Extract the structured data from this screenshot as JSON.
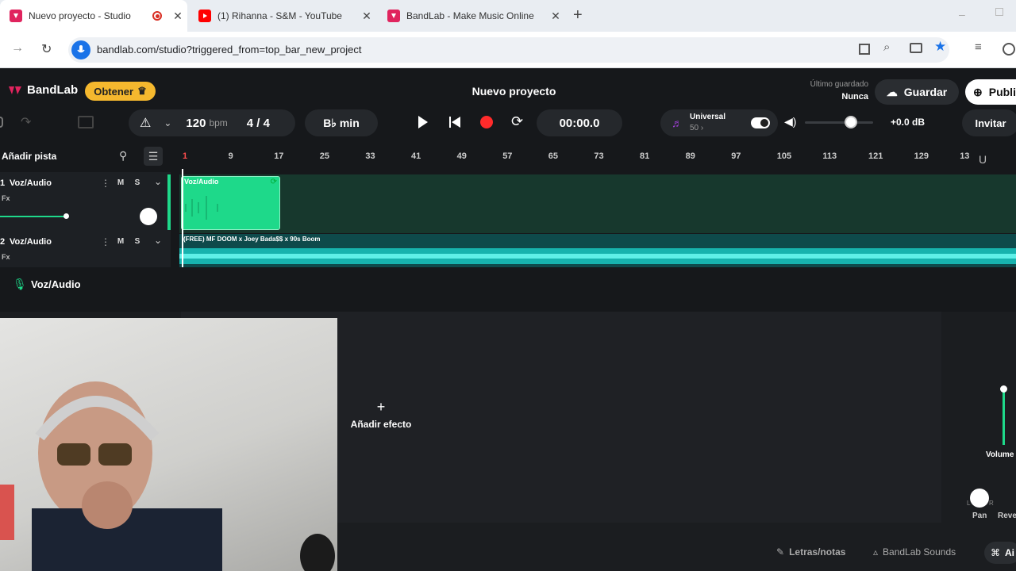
{
  "browser": {
    "tabs": [
      {
        "title": "Nuevo proyecto - Studio",
        "active": true
      },
      {
        "title": "(1) Rihanna - S&M - YouTube",
        "active": false
      },
      {
        "title": "BandLab - Make Music Online",
        "active": false
      }
    ],
    "url": "bandlab.com/studio?triggered_from=top_bar_new_project"
  },
  "header": {
    "logo": "BandLab",
    "obtener": "Obtener",
    "project_title": "Nuevo proyecto",
    "last_saved_label": "Último guardado",
    "last_saved_value": "Nunca",
    "save": "Guardar",
    "publish": "Publi"
  },
  "toolbar": {
    "bpm_value": "120",
    "bpm_unit": "bpm",
    "time_sig": "4 / 4",
    "key": "B♭ min",
    "time": "00:00.0",
    "instrument_name": "Universal",
    "instrument_sub": "50 ›",
    "volume_db": "+0.0 dB",
    "invite": "Invitar"
  },
  "ruler": [
    "1",
    "9",
    "17",
    "25",
    "33",
    "41",
    "49",
    "57",
    "65",
    "73",
    "81",
    "89",
    "97",
    "105",
    "113",
    "121",
    "129",
    "13"
  ],
  "tracks": {
    "add_track": "Añadir pista",
    "items": [
      {
        "num": "1",
        "name": "Voz/Audio",
        "fx": "Fx",
        "m": "M",
        "s": "S"
      },
      {
        "num": "2",
        "name": "Voz/Audio",
        "fx": "Fx",
        "m": "M",
        "s": "S"
      }
    ]
  },
  "clips": {
    "clip1": "Voz/Audio",
    "clip2": "(FREE) MF DOOM x Joey Bada$$ x 90s Boom"
  },
  "panel": {
    "track_name": "Voz/Audio",
    "add_effect": "Añadir efecto",
    "volume": "Volume",
    "pan": "Pan",
    "reverb": "Reve",
    "pan_l": "L",
    "pan_r": "R"
  },
  "footer": {
    "lyrics": "Letras/notas",
    "sounds": "BandLab Sounds",
    "ai": "Ai"
  },
  "colors": {
    "accent_green": "#1ed98a",
    "record_red": "#ff2b2b",
    "obtener_yellow": "#f5b82e",
    "lane_teal": "#19c6c0"
  }
}
